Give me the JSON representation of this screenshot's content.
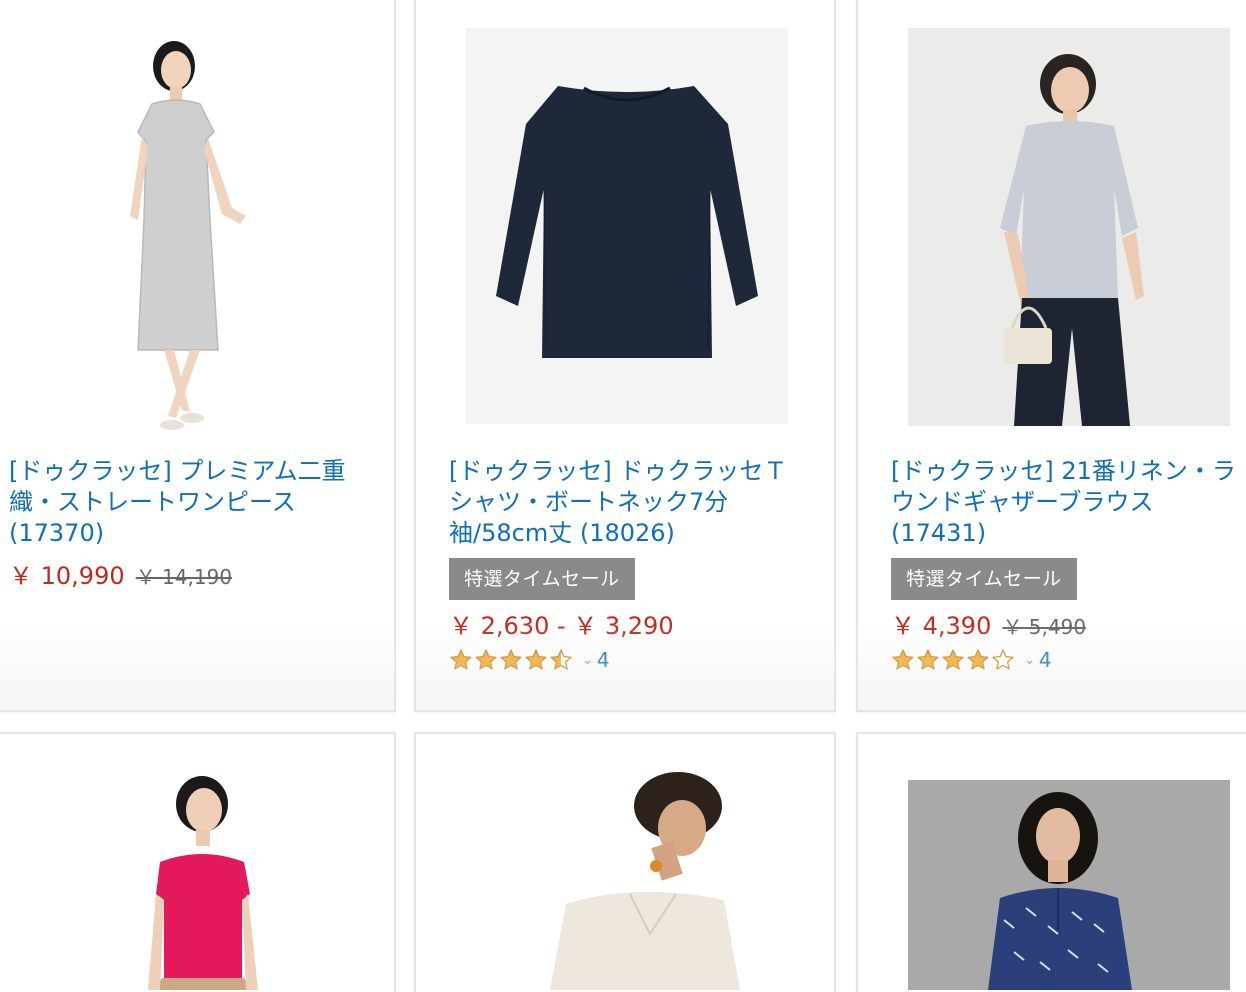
{
  "products": [
    {
      "title": "[ドゥクラッセ] プレミアム二重織・ストレートワンピース (17370)",
      "price": "￥ 10,990",
      "list_price": "￥ 14,190",
      "image": "gray-straight-dress-photo"
    },
    {
      "title": "[ドゥクラッセ] ドゥクラッセＴシャツ・ボートネック7分袖/58cm丈 (18026)",
      "badge": "特選タイムセール",
      "price": "￥ 2,630 - ￥ 3,290",
      "rating": 4.5,
      "review_count": "4",
      "image": "navy-boatneck-tshirt-photo"
    },
    {
      "title": "[ドゥクラッセ] 21番リネン・ラウンドギャザーブラウス (17431)",
      "badge": "特選タイムセール",
      "price": "￥ 4,390",
      "list_price": "￥ 5,490",
      "rating": 4.0,
      "review_count": "4",
      "image": "linen-gather-blouse-photo"
    },
    {
      "image": "pink-top-photo"
    },
    {
      "image": "beige-vneck-top-photo"
    },
    {
      "image": "navy-print-blouse-photo"
    }
  ],
  "colors": {
    "link": "#0f6fb8",
    "price": "#c0291a",
    "badge": "#8a8a8a",
    "star": "#f5a623"
  }
}
